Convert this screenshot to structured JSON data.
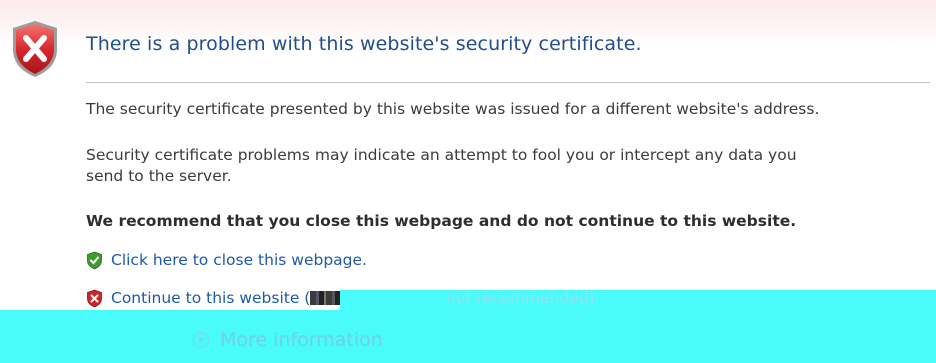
{
  "title": "There is a problem with this website's security certificate.",
  "paragraph1": "The security certificate presented by this website was issued for a different website's address.",
  "paragraph2_line1": "Security certificate problems may indicate an attempt to fool you or intercept any data you",
  "paragraph2_line2": "send to the server.",
  "recommendation": "We recommend that you close this webpage and do not continue to this website.",
  "close_link": "Click here to close this webpage.",
  "continue_link_prefix": "Continue to this website (",
  "continue_link_suffix": "not recommended).",
  "more_info": "More information",
  "colors": {
    "title": "#1f4e8c",
    "link": "#1f5aa6",
    "overlay": "#49fbfb",
    "shield_red": "#c8262b",
    "shield_green": "#3f9b2f"
  },
  "icons": {
    "main": "error-shield-icon",
    "close": "green-shield-icon",
    "continue": "red-shield-icon",
    "more_info": "chevron-down-icon"
  }
}
